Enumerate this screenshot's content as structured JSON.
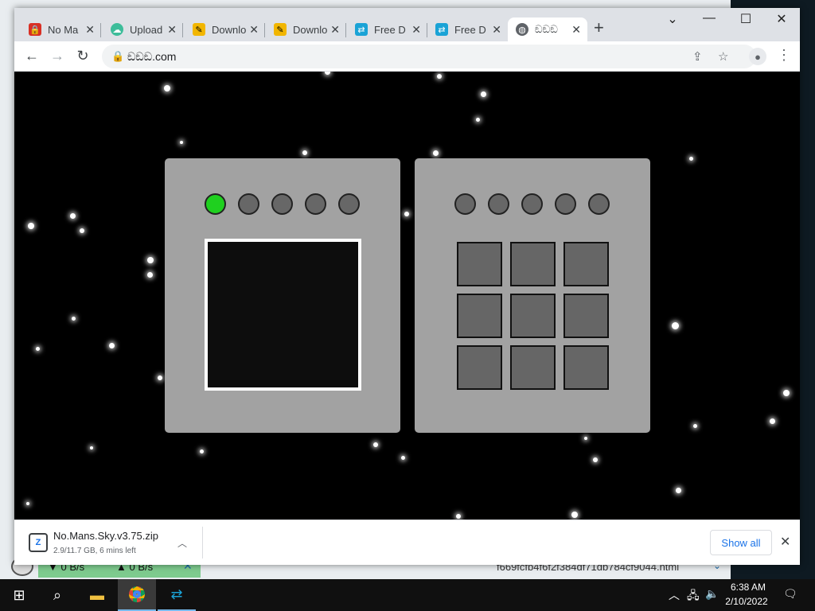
{
  "browser": {
    "tabs": [
      {
        "title": "No Ma",
        "favicon_color": "#d93025"
      },
      {
        "title": "Upload",
        "favicon_color": "#3dbd9a"
      },
      {
        "title": "Downlo",
        "favicon_color": "#f2b600"
      },
      {
        "title": "Downlo",
        "favicon_color": "#f2b600"
      },
      {
        "title": "Free D",
        "favicon_color": "#1aa3d6"
      },
      {
        "title": "Free D",
        "favicon_color": "#1aa3d6"
      },
      {
        "title": "ඞඞඞ",
        "favicon_color": "#5f6368"
      }
    ],
    "active_tab": 6,
    "url": "ඞඞඞ.com"
  },
  "game": {
    "left_panel": {
      "indicators_lit": 1,
      "indicator_count": 5
    },
    "right_panel": {
      "indicator_count": 5,
      "grid_rows": 3,
      "grid_cols": 3
    },
    "indicator_on_color": "#1fd01f",
    "indicator_off_color": "#676767"
  },
  "download": {
    "filename": "No.Mans.Sky.v3.75.zip",
    "status": "2.9/11.7 GB, 6 mins left",
    "show_all": "Show all"
  },
  "background_app": {
    "download_rate": "▼ 0 B/s",
    "upload_rate": "▲ 0 B/s",
    "hash": "f669fcfb4f6f2f384df71db784cf9044.html"
  },
  "taskbar": {
    "time": "6:38 AM",
    "date": "2/10/2022"
  }
}
